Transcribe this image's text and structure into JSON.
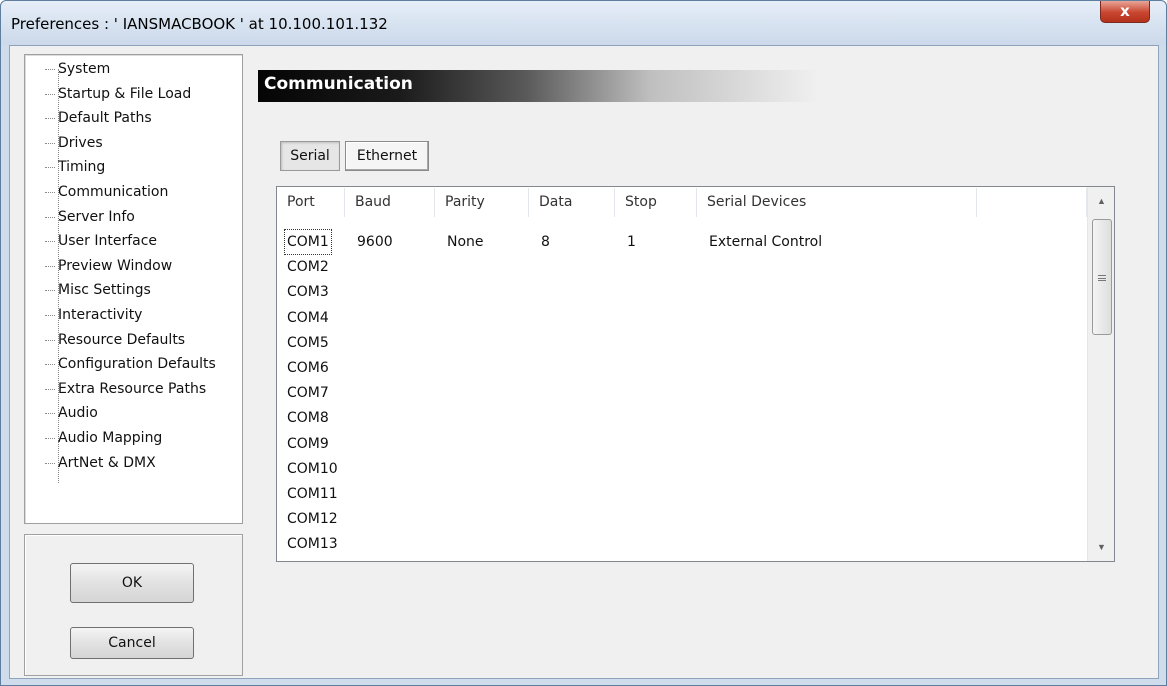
{
  "window": {
    "title": "Preferences  :  ' IANSMACBOOK '  at  10.100.101.132",
    "close_label": "x"
  },
  "sidebar": {
    "items": [
      {
        "label": "System"
      },
      {
        "label": "Startup & File Load"
      },
      {
        "label": "Default Paths"
      },
      {
        "label": "Drives"
      },
      {
        "label": "Timing"
      },
      {
        "label": "Communication"
      },
      {
        "label": "Server Info"
      },
      {
        "label": "User Interface"
      },
      {
        "label": "Preview Window"
      },
      {
        "label": "Misc Settings"
      },
      {
        "label": "Interactivity"
      },
      {
        "label": "Resource Defaults"
      },
      {
        "label": "Configuration Defaults"
      },
      {
        "label": "Extra Resource Paths"
      },
      {
        "label": "Audio"
      },
      {
        "label": "Audio Mapping"
      },
      {
        "label": "ArtNet & DMX"
      }
    ],
    "selected": "Communication"
  },
  "buttons": {
    "ok_label": "OK",
    "cancel_label": "Cancel"
  },
  "main": {
    "section_title": "Communication",
    "tabs": [
      {
        "label": "Serial",
        "active": true
      },
      {
        "label": "Ethernet",
        "active": false
      }
    ],
    "table": {
      "columns": [
        "Port",
        "Baud",
        "Parity",
        "Data",
        "Stop",
        "Serial Devices"
      ],
      "rows": [
        {
          "port": "COM1",
          "baud": "9600",
          "parity": "None",
          "data": "8",
          "stop": "1",
          "device": "External Control"
        },
        {
          "port": "COM2",
          "baud": "",
          "parity": "",
          "data": "",
          "stop": "",
          "device": ""
        },
        {
          "port": "COM3",
          "baud": "",
          "parity": "",
          "data": "",
          "stop": "",
          "device": ""
        },
        {
          "port": "COM4",
          "baud": "",
          "parity": "",
          "data": "",
          "stop": "",
          "device": ""
        },
        {
          "port": "COM5",
          "baud": "",
          "parity": "",
          "data": "",
          "stop": "",
          "device": ""
        },
        {
          "port": "COM6",
          "baud": "",
          "parity": "",
          "data": "",
          "stop": "",
          "device": ""
        },
        {
          "port": "COM7",
          "baud": "",
          "parity": "",
          "data": "",
          "stop": "",
          "device": ""
        },
        {
          "port": "COM8",
          "baud": "",
          "parity": "",
          "data": "",
          "stop": "",
          "device": ""
        },
        {
          "port": "COM9",
          "baud": "",
          "parity": "",
          "data": "",
          "stop": "",
          "device": ""
        },
        {
          "port": "COM10",
          "baud": "",
          "parity": "",
          "data": "",
          "stop": "",
          "device": ""
        },
        {
          "port": "COM11",
          "baud": "",
          "parity": "",
          "data": "",
          "stop": "",
          "device": ""
        },
        {
          "port": "COM12",
          "baud": "",
          "parity": "",
          "data": "",
          "stop": "",
          "device": ""
        },
        {
          "port": "COM13",
          "baud": "",
          "parity": "",
          "data": "",
          "stop": "",
          "device": ""
        }
      ]
    }
  },
  "icons": {
    "close": "close-icon",
    "scroll_up": "scroll-up-arrow-icon",
    "scroll_down": "scroll-down-arrow-icon",
    "grip": "scrollbar-grip-icon"
  }
}
